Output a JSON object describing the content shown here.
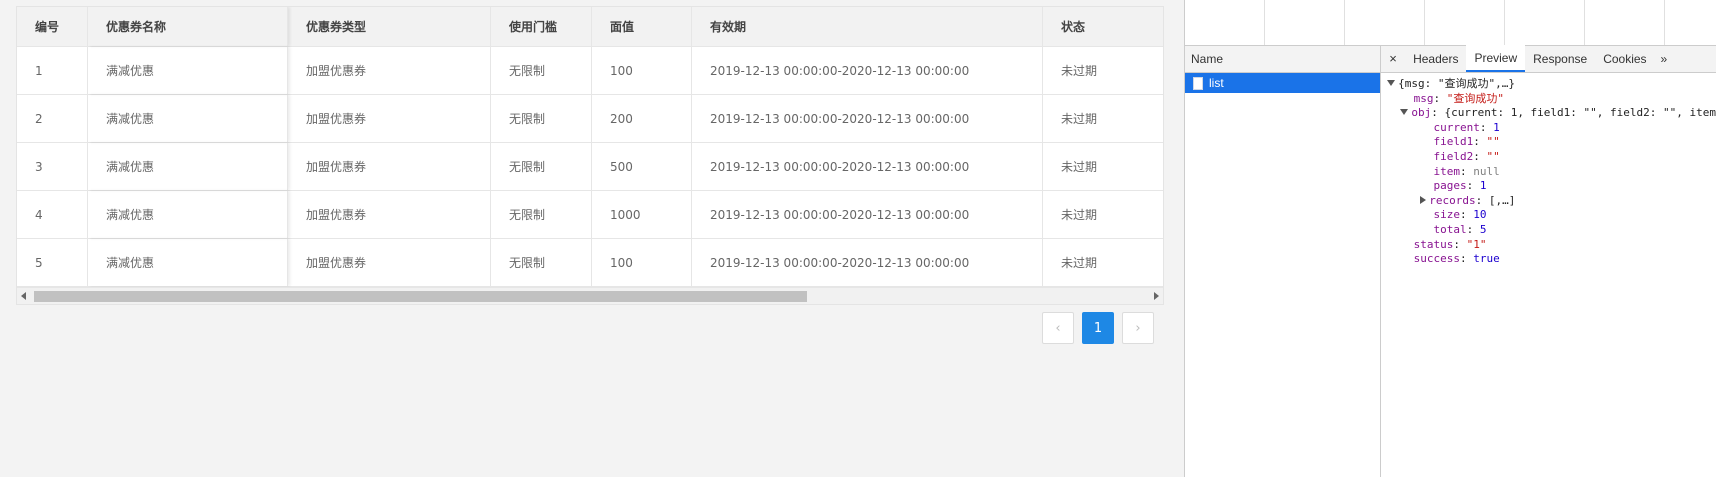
{
  "table": {
    "headers": [
      "编号",
      "优惠券名称",
      "优惠券类型",
      "使用门槛",
      "面值",
      "有效期",
      "状态"
    ],
    "rows": [
      [
        "1",
        "满减优惠",
        "加盟优惠券",
        "无限制",
        "100",
        "2019-12-13 00:00:00-2020-12-13 00:00:00",
        "未过期"
      ],
      [
        "2",
        "满减优惠",
        "加盟优惠券",
        "无限制",
        "200",
        "2019-12-13 00:00:00-2020-12-13 00:00:00",
        "未过期"
      ],
      [
        "3",
        "满减优惠",
        "加盟优惠券",
        "无限制",
        "500",
        "2019-12-13 00:00:00-2020-12-13 00:00:00",
        "未过期"
      ],
      [
        "4",
        "满减优惠",
        "加盟优惠券",
        "无限制",
        "1000",
        "2019-12-13 00:00:00-2020-12-13 00:00:00",
        "未过期"
      ],
      [
        "5",
        "满减优惠",
        "加盟优惠券",
        "无限制",
        "100",
        "2019-12-13 00:00:00-2020-12-13 00:00:00",
        "未过期"
      ]
    ]
  },
  "pager": {
    "prev": "‹",
    "current": "1",
    "next": "›"
  },
  "devtools": {
    "name_header": "Name",
    "request_name": "list",
    "close": "×",
    "tabs": [
      "Headers",
      "Preview",
      "Response",
      "Cookies"
    ],
    "active_tab": "Preview",
    "more": "»",
    "json": {
      "root_summary": "{msg: \"查询成功\",…}",
      "msg_key": "msg",
      "msg_val": "\"查询成功\"",
      "obj_key": "obj",
      "obj_summary": "{current: 1, field1: \"\", field2: \"\", item",
      "current_key": "current",
      "current_val": "1",
      "field1_key": "field1",
      "field1_val": "\"\"",
      "field2_key": "field2",
      "field2_val": "\"\"",
      "item_key": "item",
      "item_val": "null",
      "pages_key": "pages",
      "pages_val": "1",
      "records_key": "records",
      "records_val": "[,…]",
      "size_key": "size",
      "size_val": "10",
      "total_key": "total",
      "total_val": "5",
      "status_key": "status",
      "status_val": "\"1\"",
      "success_key": "success",
      "success_val": "true"
    }
  }
}
